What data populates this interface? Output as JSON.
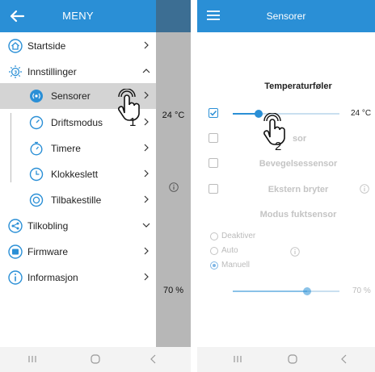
{
  "left": {
    "header": {
      "title": "MENY"
    },
    "menu": [
      {
        "label": "Startside"
      },
      {
        "label": "Innstillinger"
      },
      {
        "label": "Sensorer"
      },
      {
        "label": "Driftsmodus"
      },
      {
        "label": "Timere"
      },
      {
        "label": "Klokkeslett"
      },
      {
        "label": "Tilbakestille"
      },
      {
        "label": "Tilkobling"
      },
      {
        "label": "Firmware"
      },
      {
        "label": "Informasjon"
      }
    ],
    "stub": {
      "temp": "24 °C",
      "humidity": "70 %"
    },
    "callout": "1"
  },
  "right": {
    "header": {
      "title": "Sensorer"
    },
    "temperature": {
      "heading": "Temperaturføler",
      "value": "24 °C",
      "level_percent": 24
    },
    "humidity_heading_partial": "sor",
    "motion": {
      "label": "Bevegelsessensor"
    },
    "external": {
      "label": "Ekstern bryter"
    },
    "mode": {
      "heading": "Modus fuktsensor",
      "options": [
        "Deaktiver",
        "Auto",
        "Manuell"
      ],
      "selected": "Manuell"
    },
    "humidity": {
      "value": "70 %",
      "level_percent": 70
    },
    "callout": "2"
  },
  "colors": {
    "accent": "#2a8fd6",
    "stub": "#b7b7b7",
    "stub_header": "#3c6e93",
    "active_row": "#d4d4d4"
  }
}
